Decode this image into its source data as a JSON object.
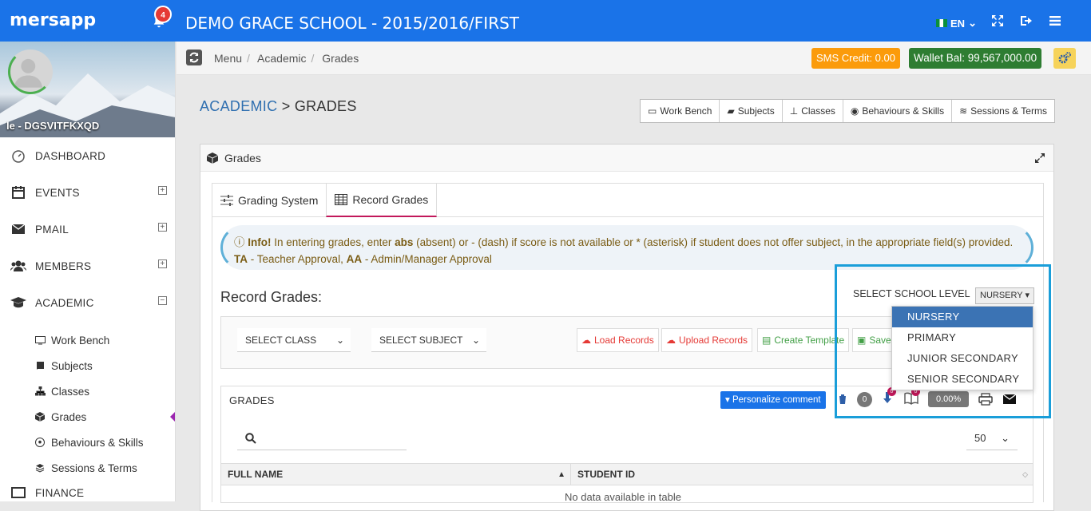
{
  "app": {
    "logo": "mersapp",
    "notifications": "4",
    "school_title": "DEMO GRACE SCHOOL - 2015/2016/FIRST",
    "language": "EN"
  },
  "sidebar": {
    "profile_name": "le - DGSVITFKXQD",
    "items": [
      {
        "label": "DASHBOARD",
        "icon": "dashboard-icon",
        "expandable": false
      },
      {
        "label": "EVENTS",
        "icon": "calendar-icon",
        "expandable": true
      },
      {
        "label": "PMAIL",
        "icon": "envelope-icon",
        "expandable": true
      },
      {
        "label": "MEMBERS",
        "icon": "users-icon",
        "expandable": true
      },
      {
        "label": "ACADEMIC",
        "icon": "graduation-cap-icon",
        "expandable": true,
        "expanded": true
      }
    ],
    "academic_sub": [
      {
        "label": "Work Bench",
        "icon": "monitor-icon"
      },
      {
        "label": "Subjects",
        "icon": "book-icon"
      },
      {
        "label": "Classes",
        "icon": "sitemap-icon"
      },
      {
        "label": "Grades",
        "icon": "cube-icon",
        "active": true
      },
      {
        "label": "Behaviours & Skills",
        "icon": "soccer-ball-icon"
      },
      {
        "label": "Sessions & Terms",
        "icon": "layers-icon"
      }
    ],
    "next_item": "FINANCE"
  },
  "breadcrumb": {
    "items": [
      "Menu",
      "Academic",
      "Grades"
    ]
  },
  "credits": {
    "sms": "SMS Credit: 0.00",
    "wallet": "Wallet Bal: 99,567,000.00"
  },
  "page": {
    "title_link": "ACADEMIC",
    "title_rest": " > GRADES",
    "quick_links": [
      "Work Bench",
      "Subjects",
      "Classes",
      "Behaviours & Skills",
      "Sessions & Terms"
    ]
  },
  "panel": {
    "title": "Grades",
    "tabs": [
      {
        "label": "Grading System"
      },
      {
        "label": "Record Grades",
        "active": true
      }
    ],
    "info": {
      "prefix": "Info!",
      "t1": " In entering grades, enter ",
      "abs": "abs",
      "t2": " (absent) or - (dash) if score is not available or * (asterisk) if student does not offer subject, in the appropriate field(s) provided. ",
      "ta": "TA",
      "t3": " - Teacher Approval, ",
      "aa": "AA",
      "t4": " - Admin/Manager Approval"
    },
    "record_title": "Record Grades:",
    "level_label": "SELECT SCHOOL LEVEL",
    "level_selected": "NURSERY",
    "level_options": [
      "NURSERY",
      "PRIMARY",
      "JUNIOR SECONDARY",
      "SENIOR SECONDARY"
    ],
    "filters": {
      "class": "SELECT CLASS",
      "subject": "SELECT SUBJECT"
    },
    "actions": {
      "load": "Load Records",
      "upload": "Upload Records",
      "template": "Create Template",
      "save": "Save"
    }
  },
  "grades": {
    "title": "GRADES",
    "personalize": "Personalize comment",
    "count": "0",
    "badge1": "0",
    "badge2": "0",
    "percent": "0.00%",
    "page_size": "50",
    "columns": [
      "FULL NAME",
      "STUDENT ID"
    ],
    "no_data": "No data available in table"
  },
  "colors": {
    "topbar": "#1a73e8",
    "sms": "#fb9b0b",
    "wallet": "#2e7d32",
    "dropdown_selected": "#3b73b4",
    "highlight": "#1a9ed9"
  }
}
